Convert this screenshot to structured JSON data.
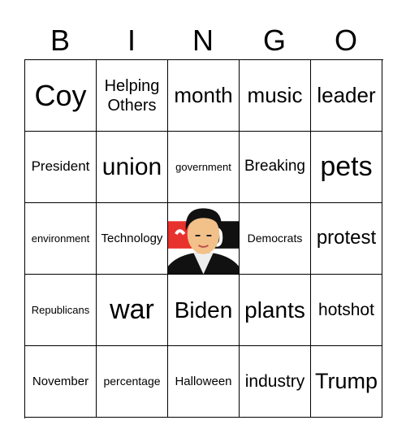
{
  "header": [
    "B",
    "I",
    "N",
    "G",
    "O"
  ],
  "cells": [
    "Coy",
    "Helping Others",
    "month",
    "music",
    "leader",
    "President",
    "union",
    "government",
    "Breaking",
    "pets",
    "environment",
    "Technology",
    "",
    "Democrats",
    "protest",
    "Republicans",
    "war",
    "Biden",
    "plants",
    "hotshot",
    "November",
    "percentage",
    "Halloween",
    "industry",
    "Trump"
  ],
  "free_space": {
    "icon": "man-portrait-news-logo-icon",
    "accent": "#e8322e"
  }
}
